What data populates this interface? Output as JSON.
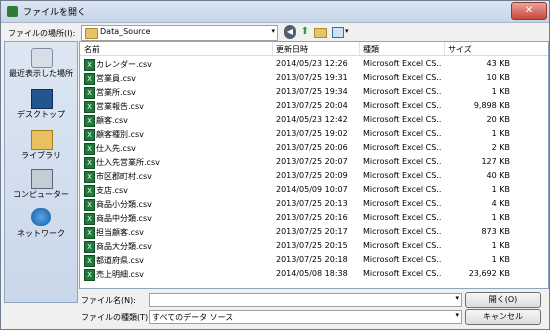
{
  "window": {
    "title": "ファイルを開く",
    "close_label": "✕"
  },
  "location": {
    "label": "ファイルの場所(I):",
    "value": "Data_Source",
    "arrow": "▾"
  },
  "toolbar": {
    "back": "◀",
    "up": "⬆",
    "view_arrow": "▾"
  },
  "places": [
    {
      "label": "最近表示した場所",
      "icon": "recent-places-icon"
    },
    {
      "label": "デスクトップ",
      "icon": "desktop-icon"
    },
    {
      "label": "ライブラリ",
      "icon": "library-icon"
    },
    {
      "label": "コンピューター",
      "icon": "computer-icon"
    },
    {
      "label": "ネットワーク",
      "icon": "network-icon"
    }
  ],
  "columns": {
    "name": "名前",
    "date": "更新日時",
    "type": "種類",
    "size": "サイズ"
  },
  "files": [
    {
      "name": "カレンダー.csv",
      "date": "2014/05/23 12:26",
      "type": "Microsoft Excel CS...",
      "size": "43 KB"
    },
    {
      "name": "営業員.csv",
      "date": "2013/07/25 19:31",
      "type": "Microsoft Excel CS...",
      "size": "10 KB"
    },
    {
      "name": "営業所.csv",
      "date": "2013/07/25 19:34",
      "type": "Microsoft Excel CS...",
      "size": "1 KB"
    },
    {
      "name": "営業報告.csv",
      "date": "2013/07/25 20:04",
      "type": "Microsoft Excel CS...",
      "size": "9,898 KB"
    },
    {
      "name": "顧客.csv",
      "date": "2014/05/23 12:42",
      "type": "Microsoft Excel CS...",
      "size": "20 KB"
    },
    {
      "name": "顧客種別.csv",
      "date": "2013/07/25 19:02",
      "type": "Microsoft Excel CS...",
      "size": "1 KB"
    },
    {
      "name": "仕入先.csv",
      "date": "2013/07/25 20:06",
      "type": "Microsoft Excel CS...",
      "size": "2 KB"
    },
    {
      "name": "仕入先営業所.csv",
      "date": "2013/07/25 20:07",
      "type": "Microsoft Excel CS...",
      "size": "127 KB"
    },
    {
      "name": "市区郡町村.csv",
      "date": "2013/07/25 20:09",
      "type": "Microsoft Excel CS...",
      "size": "40 KB"
    },
    {
      "name": "支店.csv",
      "date": "2014/05/09 10:07",
      "type": "Microsoft Excel CS...",
      "size": "1 KB"
    },
    {
      "name": "商品小分類.csv",
      "date": "2013/07/25 20:13",
      "type": "Microsoft Excel CS...",
      "size": "4 KB"
    },
    {
      "name": "商品中分類.csv",
      "date": "2013/07/25 20:16",
      "type": "Microsoft Excel CS...",
      "size": "1 KB"
    },
    {
      "name": "担当顧客.csv",
      "date": "2013/07/25 20:17",
      "type": "Microsoft Excel CS...",
      "size": "873 KB"
    },
    {
      "name": "商品大分類.csv",
      "date": "2013/07/25 20:15",
      "type": "Microsoft Excel CS...",
      "size": "1 KB"
    },
    {
      "name": "都道府県.csv",
      "date": "2013/07/25 20:18",
      "type": "Microsoft Excel CS...",
      "size": "1 KB"
    },
    {
      "name": "売上明細.csv",
      "date": "2014/05/08 18:38",
      "type": "Microsoft Excel CS...",
      "size": "23,692 KB"
    }
  ],
  "bottom": {
    "filename_label": "ファイル名(N):",
    "filename_value": "",
    "filetype_label": "ファイルの種類(T):",
    "filetype_value": "すべてのデータ ソース",
    "open_button": "開く(O)",
    "cancel_button": "キャンセル"
  }
}
